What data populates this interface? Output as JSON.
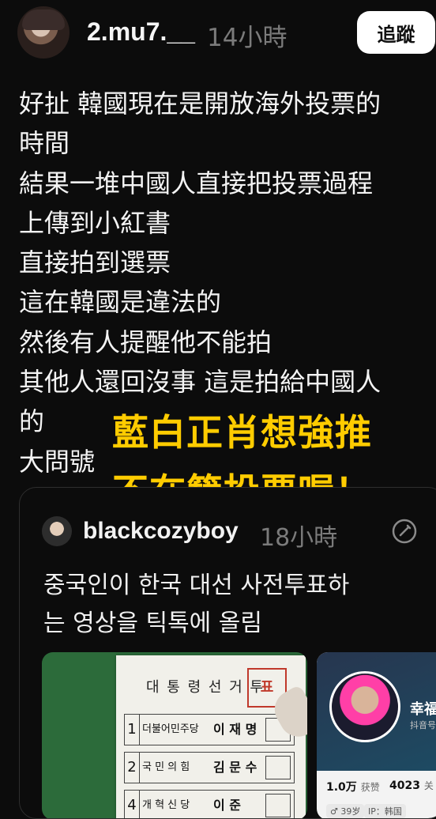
{
  "post": {
    "username": "2.mu7.__",
    "time": "14小時",
    "follow_label": "追蹤",
    "body": "好扯 韓國現在是開放海外投票的\n時間\n結果一堆中國人直接把投票過程\n上傳到小紅書\n直接拍到選票\n這在韓國是違法的\n然後有人提醒他不能拍\n其他人還回沒事 這是拍給中國人\n的\n大問號",
    "overlay_caption": "藍白正肖想強推\n不在籍投票喔！"
  },
  "quoted_post": {
    "username": "blackcozyboy",
    "time": "18小時",
    "text": "중국인이 한국 대선 사전투표하\n는 영상을 틱톡에 올림",
    "media": {
      "ballot": {
        "title": "대 통 령 선 거 투",
        "stamp": "표",
        "rows": [
          {
            "num": "1",
            "party": "더불어민주당",
            "name": "이 재 명"
          },
          {
            "num": "2",
            "party": "국 민 의 힘",
            "name": "김 문 수"
          },
          {
            "num": "4",
            "party": "개 혁 신 당",
            "name": "이 준"
          }
        ]
      },
      "profile_card": {
        "name": "幸福",
        "sub": "抖音号",
        "likes_value": "1.0万",
        "likes_label": "获赞",
        "following_value": "4023",
        "following_label": "关",
        "tag_age": "♂ 39岁",
        "tag_ip": "IP：韩国"
      }
    }
  },
  "colors": {
    "background": "#0c0c0c",
    "overlay_text": "#ffcc00",
    "muted": "#7b7b7b"
  }
}
